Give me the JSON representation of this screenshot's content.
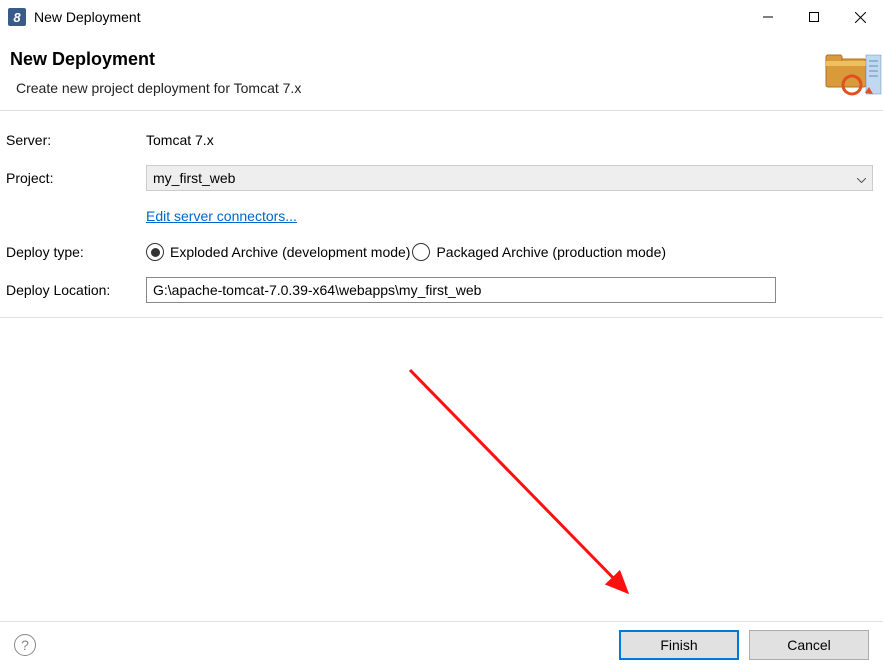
{
  "window": {
    "title": "New Deployment"
  },
  "header": {
    "title": "New Deployment",
    "description": "Create new project deployment for Tomcat  7.x"
  },
  "form": {
    "server_label": "Server:",
    "server_value": "Tomcat  7.x",
    "project_label": "Project:",
    "project_selected": "my_first_web",
    "edit_connectors_link": "Edit server connectors...",
    "deploy_type_label": "Deploy type:",
    "deploy_type_exploded": "Exploded Archive (development mode)",
    "deploy_type_packaged": "Packaged Archive (production mode)",
    "deploy_type_selected": "exploded",
    "deploy_location_label": "Deploy Location:",
    "deploy_location_value": "G:\\apache-tomcat-7.0.39-x64\\webapps\\my_first_web"
  },
  "footer": {
    "finish_label": "Finish",
    "cancel_label": "Cancel"
  }
}
